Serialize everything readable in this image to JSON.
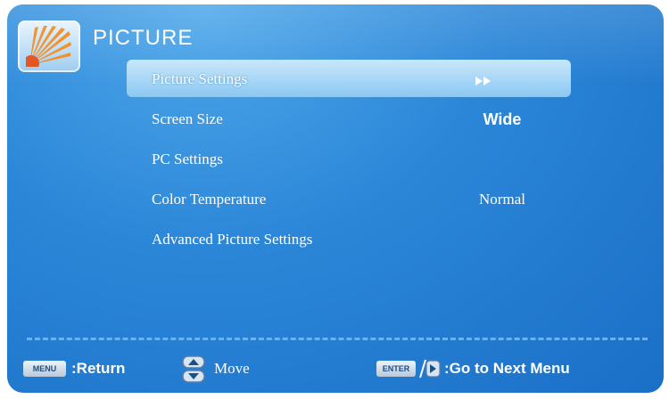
{
  "header": {
    "title": "PICTURE",
    "icon": "sun-rays-icon"
  },
  "menu": {
    "items": [
      {
        "label": "Picture Settings",
        "value": "",
        "selected": true,
        "submenu_indicator": "▶▶"
      },
      {
        "label": "Screen Size",
        "value": "Wide",
        "selected": false
      },
      {
        "label": "PC Settings",
        "value": "",
        "selected": false
      },
      {
        "label": "Color Temperature",
        "value": "Normal",
        "selected": false
      },
      {
        "label": "Advanced Picture Settings",
        "value": "",
        "selected": false
      }
    ]
  },
  "footer": {
    "menu_key": "MENU",
    "return_label": ":Return",
    "move_label": "Move",
    "enter_key": "ENTER",
    "next_label": ":Go to Next Menu"
  },
  "colors": {
    "background": "#2b86d8",
    "selected_row": "#a9d6f6",
    "text": "#ffffff",
    "divider": "#6fb3e9"
  }
}
